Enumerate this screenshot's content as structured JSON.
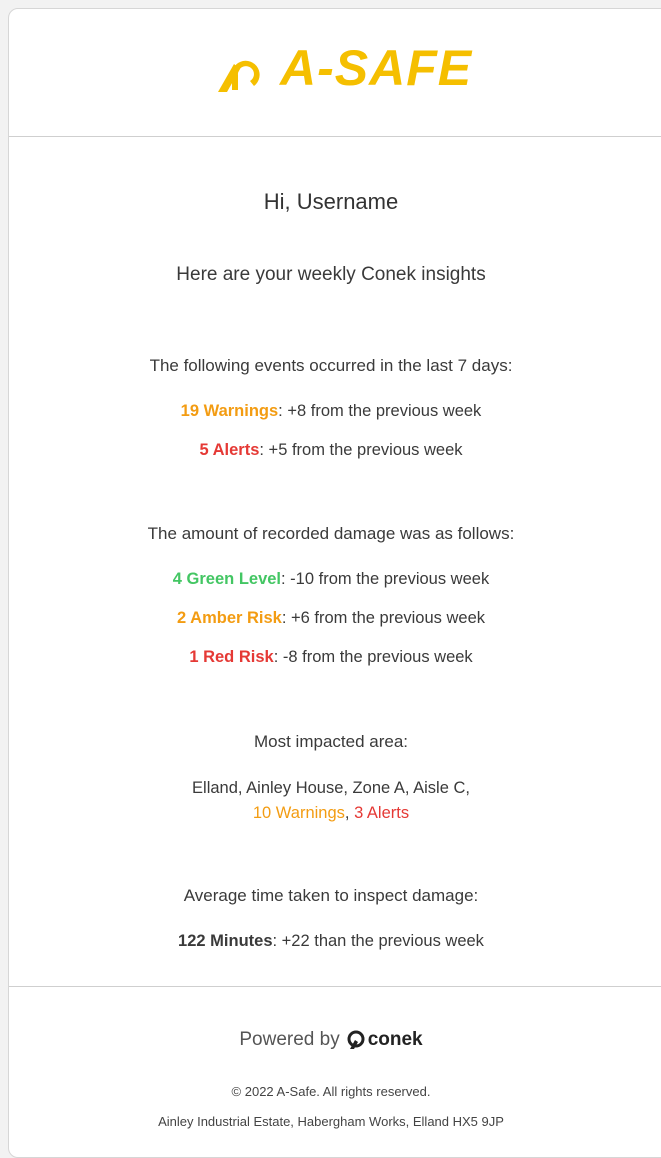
{
  "brand": {
    "name": "A-SAFE",
    "color": "#f5bf00"
  },
  "greeting": "Hi, Username",
  "intro": "Here are your weekly Conek insights",
  "events": {
    "title": "The following events occurred in the last 7 days:",
    "items": [
      {
        "count_label": "19 Warnings",
        "detail": ": +8 from the previous week",
        "color": "#f39c12"
      },
      {
        "count_label": "5 Alerts",
        "detail": ": +5 from the previous week",
        "color": "#e53935"
      }
    ]
  },
  "damage": {
    "title": "The amount of recorded damage was as follows:",
    "items": [
      {
        "count_label": "4 Green Level",
        "detail": ": -10 from the previous week",
        "color": "#43c663"
      },
      {
        "count_label": "2 Amber Risk",
        "detail": ": +6 from the previous week",
        "color": "#f39c12"
      },
      {
        "count_label": "1 Red Risk",
        "detail": ": -8 from the previous week",
        "color": "#e53935"
      }
    ]
  },
  "impacted": {
    "title": "Most impacted area:",
    "location": "Elland, Ainley House, Zone A, Aisle C,",
    "warnings": "10 Warnings",
    "separator": ",",
    "alerts": "3 Alerts"
  },
  "inspection": {
    "title": "Average time taken to inspect damage:",
    "value": "122 Minutes",
    "detail": ": +22 than the previous week"
  },
  "footer": {
    "powered_by": "Powered by",
    "powered_brand": "conek",
    "copyright": "© 2022 A-Safe. All rights reserved.",
    "address": "Ainley Industrial Estate, Habergham Works, Elland HX5 9JP"
  }
}
